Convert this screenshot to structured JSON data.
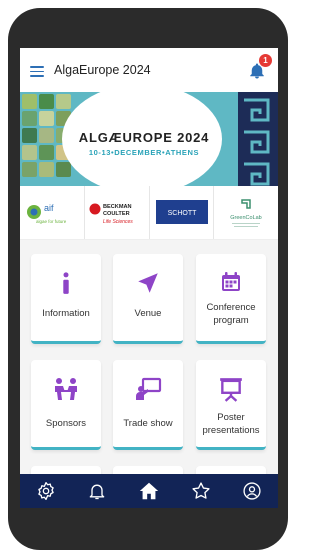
{
  "header": {
    "title": "AlgaEurope 2024",
    "notification_count": "1"
  },
  "banner": {
    "title": "ALGÆUROPE 2024",
    "subtitle": "10-13•DECEMBER•ATHENS"
  },
  "sponsor_logos": [
    {
      "name": "aif",
      "text": "aif",
      "tagline": "algae for future"
    },
    {
      "name": "beckman-coulter",
      "text": "BECKMAN COULTER",
      "tagline": "Life Sciences"
    },
    {
      "name": "schott",
      "text": "SCHOTT"
    },
    {
      "name": "greencolab",
      "text": "GreenCoLab"
    }
  ],
  "tiles": [
    {
      "label": "Information",
      "icon": "info-icon"
    },
    {
      "label": "Venue",
      "icon": "navigation-arrow-icon"
    },
    {
      "label": "Conference program",
      "icon": "calendar-icon"
    },
    {
      "label": "Sponsors",
      "icon": "people-meeting-icon"
    },
    {
      "label": "Trade show",
      "icon": "presenter-screen-icon"
    },
    {
      "label": "Poster presentations",
      "icon": "easel-presentation-icon"
    }
  ],
  "bottom_nav": [
    {
      "icon": "settings-icon"
    },
    {
      "icon": "bell-icon"
    },
    {
      "icon": "home-icon"
    },
    {
      "icon": "star-icon"
    },
    {
      "icon": "profile-icon"
    }
  ],
  "colors": {
    "accent": "#8e44c7",
    "nav_bg": "#122456",
    "teal": "#42b3c4",
    "header_icon": "#2d6fb5",
    "badge": "#e53935"
  }
}
